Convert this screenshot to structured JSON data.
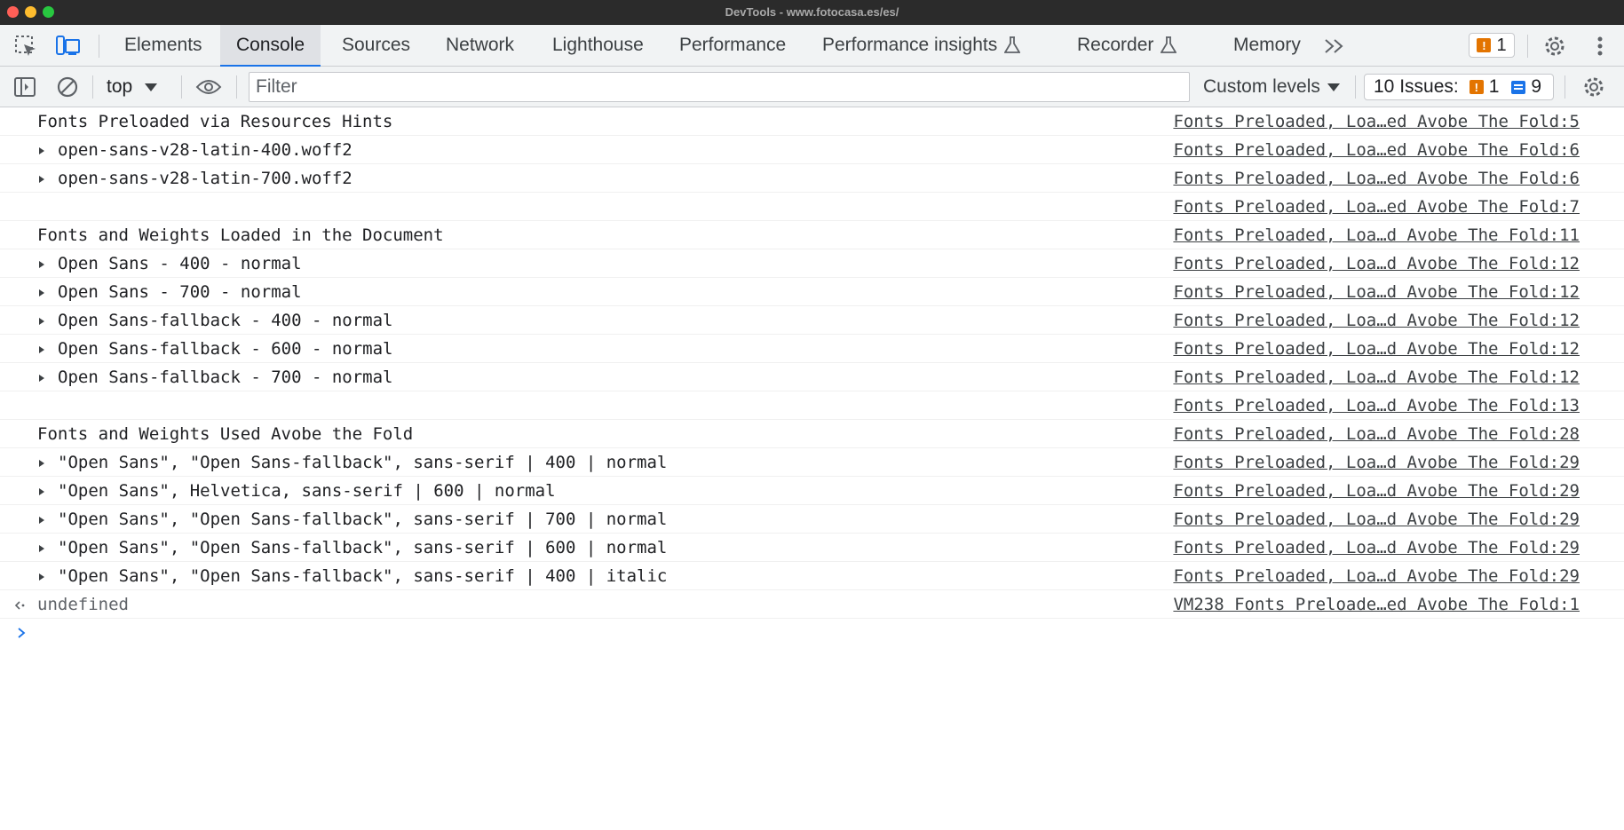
{
  "window": {
    "title": "DevTools - www.fotocasa.es/es/"
  },
  "tabs": [
    {
      "label": "Elements",
      "active": false
    },
    {
      "label": "Console",
      "active": true
    },
    {
      "label": "Sources",
      "active": false
    },
    {
      "label": "Network",
      "active": false
    },
    {
      "label": "Lighthouse",
      "active": false
    },
    {
      "label": "Performance",
      "active": false
    },
    {
      "label": "Performance insights",
      "active": false,
      "icon": "flask-icon"
    },
    {
      "label": "Recorder",
      "active": false,
      "icon": "flask-icon"
    },
    {
      "label": "Memory",
      "active": false
    }
  ],
  "tabbar": {
    "warning_count": "1",
    "icons": [
      "inspect-element-icon",
      "device-toolbar-icon",
      "more-tabs-icon",
      "settings-icon",
      "kebab-menu-icon"
    ]
  },
  "toolbar": {
    "context": "top",
    "filter_placeholder": "Filter",
    "levels_label": "Custom levels",
    "issues_label": "10 Issues:",
    "issues_warnings": "1",
    "issues_messages": "9",
    "icons": [
      "sidebar-toggle-icon",
      "clear-console-icon",
      "live-expression-eye-icon",
      "console-settings-icon"
    ]
  },
  "colors": {
    "accent": "#1a73e8",
    "warning": "#e37400",
    "chrome_bg": "#f1f3f4",
    "titlebar_bg": "#2b2b2b"
  },
  "console": {
    "rows": [
      {
        "text": "Fonts Preloaded via Resources Hints",
        "source": "Fonts Preloaded, Loa…ed Avobe The Fold:5",
        "expandable": false
      },
      {
        "text": "open-sans-v28-latin-400.woff2",
        "source": "Fonts Preloaded, Loa…ed Avobe The Fold:6",
        "expandable": true
      },
      {
        "text": "open-sans-v28-latin-700.woff2",
        "source": "Fonts Preloaded, Loa…ed Avobe The Fold:6",
        "expandable": true
      },
      {
        "text": "",
        "source": "Fonts Preloaded, Loa…ed Avobe The Fold:7",
        "expandable": false
      },
      {
        "text": "Fonts and Weights Loaded in the Document",
        "source": "Fonts Preloaded, Loa…d Avobe The Fold:11",
        "expandable": false
      },
      {
        "text": "Open Sans - 400 - normal",
        "source": "Fonts Preloaded, Loa…d Avobe The Fold:12",
        "expandable": true
      },
      {
        "text": "Open Sans - 700 - normal",
        "source": "Fonts Preloaded, Loa…d Avobe The Fold:12",
        "expandable": true
      },
      {
        "text": "Open Sans-fallback - 400 - normal",
        "source": "Fonts Preloaded, Loa…d Avobe The Fold:12",
        "expandable": true
      },
      {
        "text": "Open Sans-fallback - 600 - normal",
        "source": "Fonts Preloaded, Loa…d Avobe The Fold:12",
        "expandable": true
      },
      {
        "text": "Open Sans-fallback - 700 - normal",
        "source": "Fonts Preloaded, Loa…d Avobe The Fold:12",
        "expandable": true
      },
      {
        "text": "",
        "source": "Fonts Preloaded, Loa…d Avobe The Fold:13",
        "expandable": false
      },
      {
        "text": "Fonts and Weights Used Avobe the Fold",
        "source": "Fonts Preloaded, Loa…d Avobe The Fold:28",
        "expandable": false
      },
      {
        "text": "\"Open Sans\", \"Open Sans-fallback\", sans-serif | 400 | normal",
        "source": "Fonts Preloaded, Loa…d Avobe The Fold:29",
        "expandable": true
      },
      {
        "text": "\"Open Sans\", Helvetica, sans-serif | 600 | normal",
        "source": "Fonts Preloaded, Loa…d Avobe The Fold:29",
        "expandable": true
      },
      {
        "text": "\"Open Sans\", \"Open Sans-fallback\", sans-serif | 700 | normal",
        "source": "Fonts Preloaded, Loa…d Avobe The Fold:29",
        "expandable": true
      },
      {
        "text": "\"Open Sans\", \"Open Sans-fallback\", sans-serif | 600 | normal",
        "source": "Fonts Preloaded, Loa…d Avobe The Fold:29",
        "expandable": true
      },
      {
        "text": "\"Open Sans\", \"Open Sans-fallback\", sans-serif | 400 | italic",
        "source": "Fonts Preloaded, Loa…d Avobe The Fold:29",
        "expandable": true
      }
    ],
    "result": {
      "text": "undefined",
      "source": "VM238 Fonts Preloade…ed Avobe The Fold:1"
    },
    "prompt_icon": "prompt-chevron-icon"
  }
}
